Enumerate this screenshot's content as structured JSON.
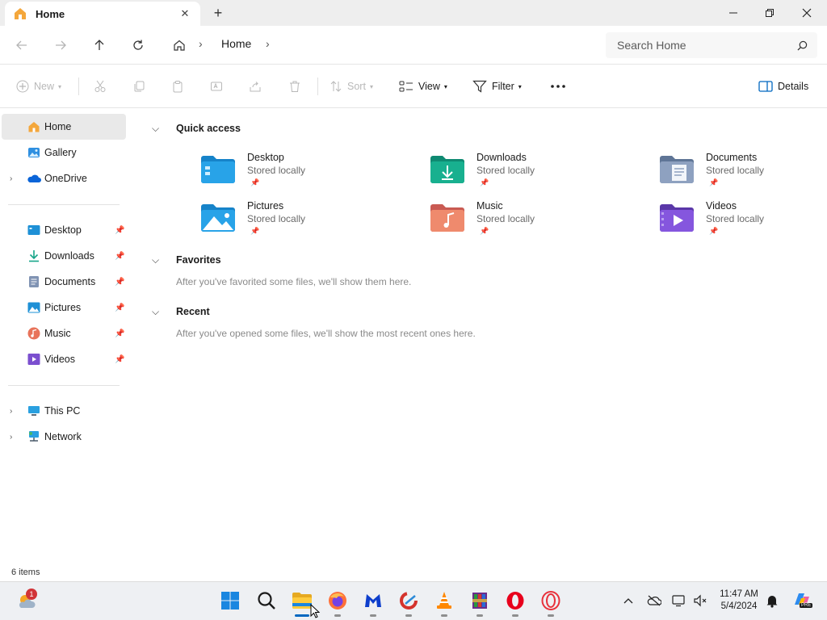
{
  "window": {
    "tab_title": "Home",
    "close_tab_glyph": "✕",
    "new_tab_glyph": "+"
  },
  "address": {
    "breadcrumb": [
      "Home"
    ],
    "search_placeholder": "Search Home"
  },
  "commands": {
    "new_label": "New",
    "sort_label": "Sort",
    "view_label": "View",
    "filter_label": "Filter",
    "details_label": "Details"
  },
  "sidebar": {
    "top": [
      {
        "label": "Home",
        "icon": "home-icon",
        "selected": true
      },
      {
        "label": "Gallery",
        "icon": "gallery-icon"
      },
      {
        "label": "OneDrive",
        "icon": "onedrive-icon",
        "expandable": true
      }
    ],
    "pinned": [
      {
        "label": "Desktop",
        "icon": "desktop-folder-icon"
      },
      {
        "label": "Downloads",
        "icon": "downloads-folder-icon"
      },
      {
        "label": "Documents",
        "icon": "documents-folder-icon"
      },
      {
        "label": "Pictures",
        "icon": "pictures-folder-icon"
      },
      {
        "label": "Music",
        "icon": "music-folder-icon"
      },
      {
        "label": "Videos",
        "icon": "videos-folder-icon"
      }
    ],
    "bottom": [
      {
        "label": "This PC",
        "icon": "this-pc-icon"
      },
      {
        "label": "Network",
        "icon": "network-icon"
      }
    ]
  },
  "main": {
    "quick_access_title": "Quick access",
    "quick_access": [
      {
        "name": "Desktop",
        "status": "Stored locally",
        "icon": "desktop-folder-icon"
      },
      {
        "name": "Downloads",
        "status": "Stored locally",
        "icon": "downloads-folder-icon"
      },
      {
        "name": "Documents",
        "status": "Stored locally",
        "icon": "documents-folder-icon"
      },
      {
        "name": "Pictures",
        "status": "Stored locally",
        "icon": "pictures-folder-icon"
      },
      {
        "name": "Music",
        "status": "Stored locally",
        "icon": "music-folder-icon"
      },
      {
        "name": "Videos",
        "status": "Stored locally",
        "icon": "videos-folder-icon"
      }
    ],
    "favorites_title": "Favorites",
    "favorites_empty": "After you've favorited some files, we'll show them here.",
    "recent_title": "Recent",
    "recent_empty": "After you've opened some files, we'll show the most recent ones here."
  },
  "status": {
    "item_count": "6 items"
  },
  "taskbar": {
    "weather_badge": "1",
    "apps": [
      "start-icon",
      "search-icon",
      "file-explorer-icon",
      "firefox-icon",
      "malwarebytes-icon",
      "ccleaner-icon",
      "vlc-icon",
      "winrar-icon",
      "opera-icon",
      "opera-gx-icon"
    ],
    "time": "11:47 AM",
    "date": "5/4/2024",
    "copilot_badge": "PRE"
  },
  "colors": {
    "accent": "#0067c0",
    "folder_blue": "#1e90d6",
    "downloads_green": "#17a589",
    "videos_purple": "#7b4fcf"
  }
}
